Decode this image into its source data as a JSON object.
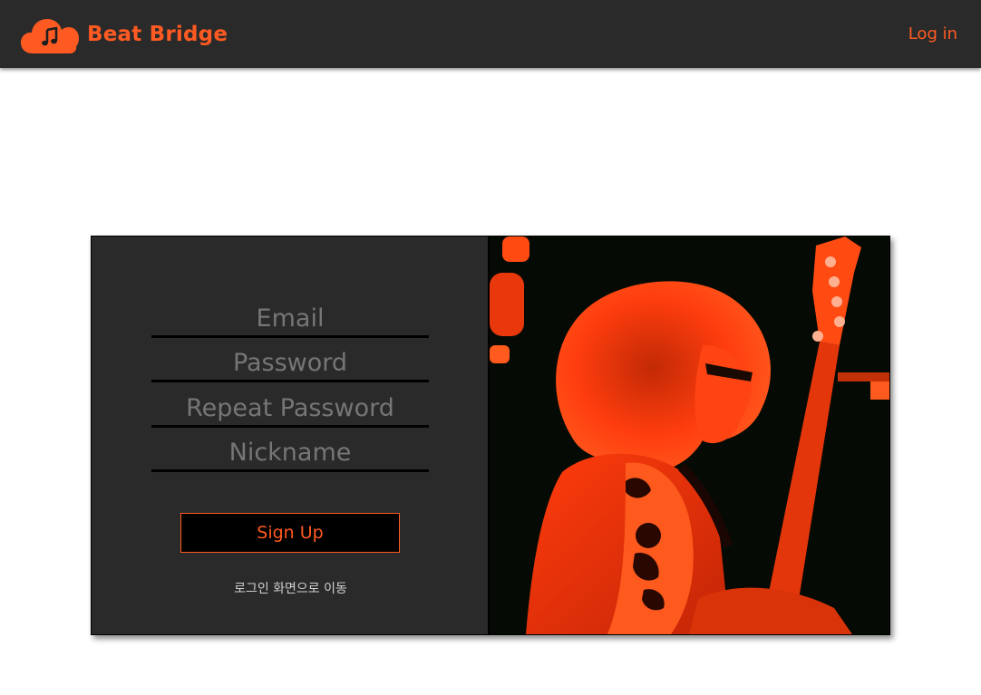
{
  "header": {
    "brand_name": "Beat Bridge",
    "login_label": "Log in",
    "logo_icon": "cloud-music-icon"
  },
  "signup_form": {
    "email_placeholder": "Email",
    "password_placeholder": "Password",
    "repeat_password_placeholder": "Repeat Password",
    "nickname_placeholder": "Nickname",
    "submit_label": "Sign Up",
    "to_login_label": "로그인 화면으로 이동"
  },
  "hero_image": {
    "subject": "guitarist-photo"
  },
  "colors": {
    "accent": "#ff5a22",
    "topbar_bg": "#2a2a2a",
    "card_bg": "#2a2a2a",
    "page_bg": "#ffffff"
  }
}
